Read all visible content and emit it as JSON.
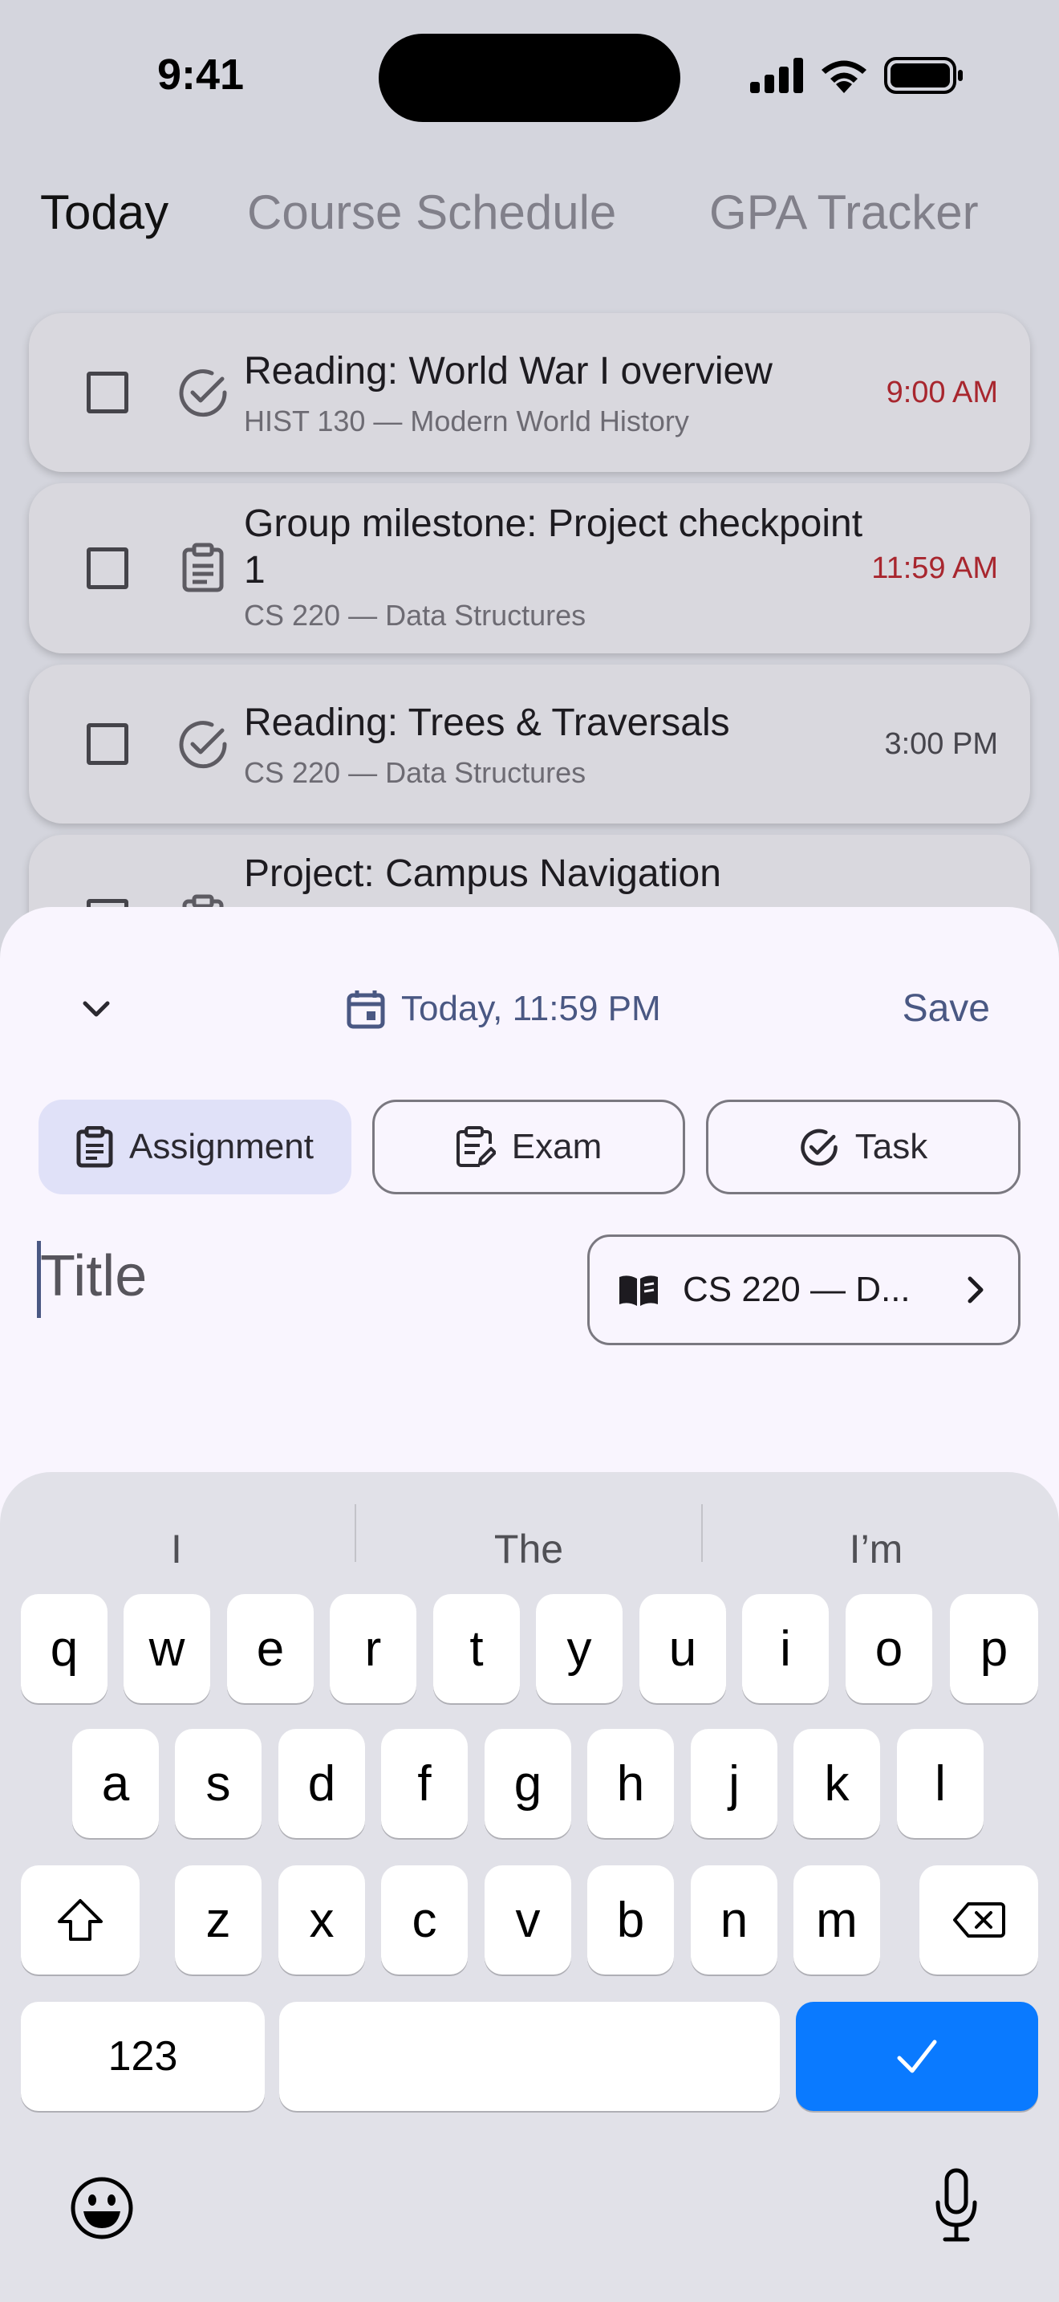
{
  "status_bar": {
    "time": "9:41"
  },
  "tabs": [
    {
      "label": "Today",
      "active": true
    },
    {
      "label": "Course Schedule",
      "active": false
    },
    {
      "label": "GPA Tracker",
      "active": false
    }
  ],
  "tasks": [
    {
      "title": "Reading: World War I overview",
      "course": "HIST 130 — Modern World History",
      "time": "9:00 AM",
      "icon": "check-circle-icon",
      "overdue": true
    },
    {
      "title": "Group milestone: Project checkpoint 1",
      "course": "CS 220 — Data Structures",
      "time": "11:59 AM",
      "icon": "clipboard-icon",
      "overdue": true
    },
    {
      "title": "Reading: Trees & Traversals",
      "course": "CS 220 — Data Structures",
      "time": "3:00 PM",
      "icon": "check-circle-icon",
      "overdue": false
    },
    {
      "title": "Project: Campus Navigation",
      "course": "",
      "time": "",
      "icon": "clipboard-icon",
      "overdue": false
    }
  ],
  "sheet": {
    "date_label": "Today, 11:59 PM",
    "save_label": "Save",
    "types": [
      {
        "label": "Assignment",
        "icon": "clipboard-icon",
        "selected": true
      },
      {
        "label": "Exam",
        "icon": "clipboard-edit-icon",
        "selected": false
      },
      {
        "label": "Task",
        "icon": "check-circle-icon",
        "selected": false
      }
    ],
    "title_placeholder": "Title",
    "title_value": "",
    "course_label": "CS 220 — D..."
  },
  "keyboard": {
    "suggestions": [
      "I",
      "The",
      "I’m"
    ],
    "row1": [
      "q",
      "w",
      "e",
      "r",
      "t",
      "y",
      "u",
      "i",
      "o",
      "p"
    ],
    "row2": [
      "a",
      "s",
      "d",
      "f",
      "g",
      "h",
      "j",
      "k",
      "l"
    ],
    "row3": [
      "z",
      "x",
      "c",
      "v",
      "b",
      "n",
      "m"
    ],
    "numbers_label": "123"
  },
  "colors": {
    "accent": "#4a5883",
    "overdue": "#a8262e",
    "keyboard_done": "#0a7aff",
    "selected_segment": "#e0e1f8"
  }
}
